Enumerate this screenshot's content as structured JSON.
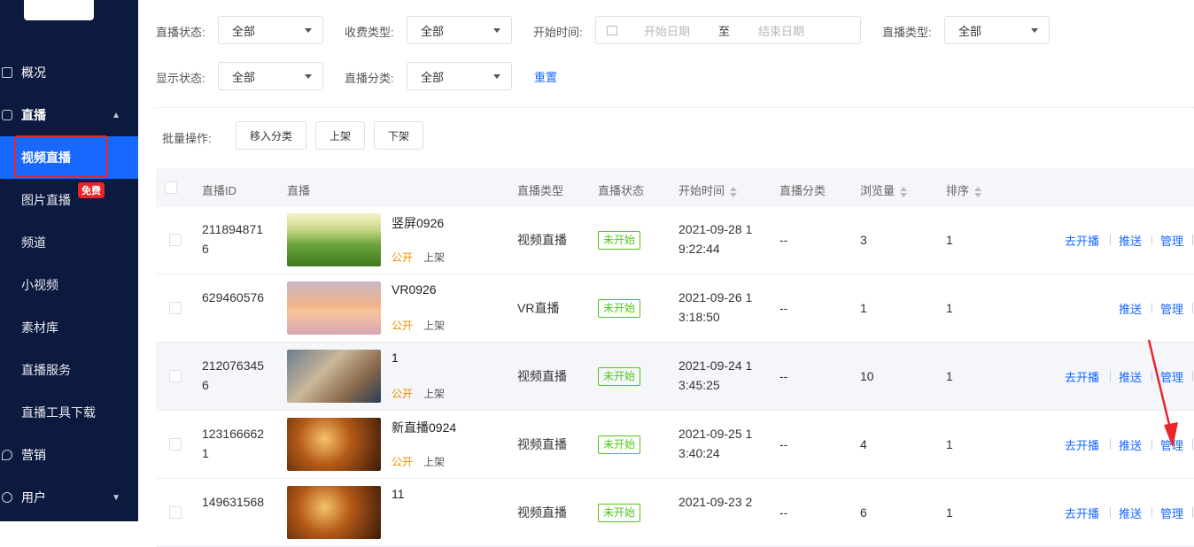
{
  "sidebar": {
    "overview": "概况",
    "live": "直播",
    "items": [
      "视频直播",
      "图片直播",
      "频道",
      "小视频",
      "素材库",
      "直播服务",
      "直播工具下载"
    ],
    "free_badge": "免费",
    "marketing": "营销",
    "users": "用户"
  },
  "filters": {
    "live_status_label": "直播状态:",
    "live_status_value": "全部",
    "fee_type_label": "收费类型:",
    "fee_type_value": "全部",
    "start_time_label": "开始时间:",
    "start_placeholder": "开始日期",
    "range_sep": "至",
    "end_placeholder": "结束日期",
    "live_type_label": "直播类型:",
    "live_type_value": "全部",
    "display_status_label": "显示状态:",
    "display_status_value": "全部",
    "category_label": "直播分类:",
    "category_value": "全部",
    "reset": "重置"
  },
  "batch": {
    "label": "批量操作:",
    "move": "移入分类",
    "on": "上架",
    "off": "下架"
  },
  "table": {
    "headers": [
      "直播ID",
      "直播",
      "直播类型",
      "直播状态",
      "开始时间",
      "直播分类",
      "浏览量",
      "排序"
    ],
    "rows": [
      {
        "id1": "211894871",
        "id2": "6",
        "title": "竖屏0926",
        "pub": "公开",
        "shelf": "上架",
        "type": "视频直播",
        "status": "未开始",
        "t1": "2021-09-28 1",
        "t2": "9:22:44",
        "cat": "--",
        "views": "3",
        "order": "1",
        "a1": "去开播",
        "a2": "推送",
        "a3": "管理"
      },
      {
        "id1": "629460576",
        "id2": "",
        "title": "VR0926",
        "pub": "公开",
        "shelf": "上架",
        "type": "VR直播",
        "status": "未开始",
        "t1": "2021-09-26 1",
        "t2": "3:18:50",
        "cat": "--",
        "views": "1",
        "order": "1",
        "a1": "",
        "a2": "推送",
        "a3": "管理"
      },
      {
        "id1": "212076345",
        "id2": "6",
        "title": "1",
        "pub": "公开",
        "shelf": "上架",
        "type": "视频直播",
        "status": "未开始",
        "t1": "2021-09-24 1",
        "t2": "3:45:25",
        "cat": "--",
        "views": "10",
        "order": "1",
        "a1": "去开播",
        "a2": "推送",
        "a3": "管理"
      },
      {
        "id1": "123166662",
        "id2": "1",
        "title": "新直播0924",
        "pub": "公开",
        "shelf": "上架",
        "type": "视频直播",
        "status": "未开始",
        "t1": "2021-09-25 1",
        "t2": "3:40:24",
        "cat": "--",
        "views": "4",
        "order": "1",
        "a1": "去开播",
        "a2": "推送",
        "a3": "管理"
      },
      {
        "id1": "149631568",
        "id2": "",
        "title": "11",
        "pub": "",
        "shelf": "",
        "type": "视频直播",
        "status": "未开始",
        "t1": "2021-09-23 2",
        "t2": "",
        "cat": "--",
        "views": "6",
        "order": "1",
        "a1": "去开播",
        "a2": "推送",
        "a3": "管理"
      }
    ]
  },
  "colors": {
    "sidebar": "#0d1a40",
    "accent": "#1768ff",
    "status": "#52c41a",
    "public": "#f08c00",
    "highlight": "#e8262a"
  }
}
